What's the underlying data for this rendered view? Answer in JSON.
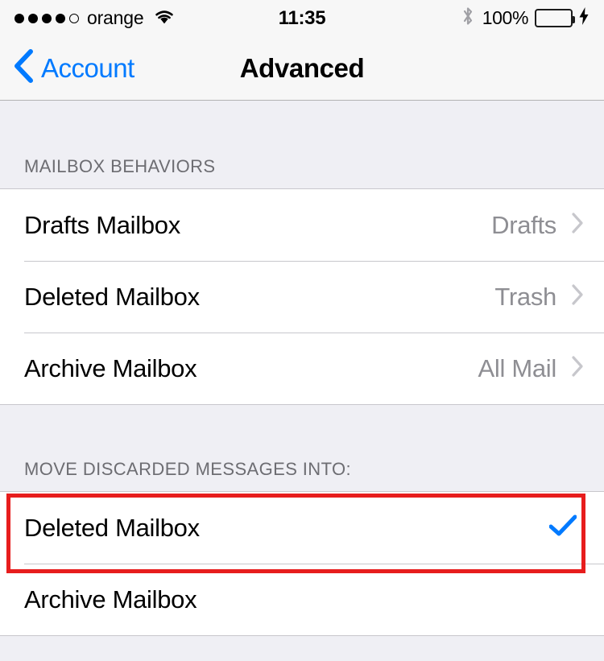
{
  "status_bar": {
    "signal_dots_filled": 4,
    "signal_dots_total": 5,
    "carrier": "orange",
    "wifi_icon": "wifi-icon",
    "time": "11:35",
    "bluetooth_icon": "bluetooth-icon",
    "battery_percent": "100%",
    "battery_level": 100,
    "battery_color": "#4CD964",
    "charging_icon": "lightning-bolt-icon"
  },
  "nav_bar": {
    "back_label": "Account",
    "back_icon": "chevron-left-icon",
    "title": "Advanced",
    "accent_color": "#007AFF"
  },
  "sections": [
    {
      "header": "MAILBOX BEHAVIORS",
      "rows": [
        {
          "label": "Drafts Mailbox",
          "value": "Drafts",
          "accessory": "disclosure"
        },
        {
          "label": "Deleted Mailbox",
          "value": "Trash",
          "accessory": "disclosure"
        },
        {
          "label": "Archive Mailbox",
          "value": "All Mail",
          "accessory": "disclosure"
        }
      ]
    },
    {
      "header": "MOVE DISCARDED MESSAGES INTO:",
      "rows": [
        {
          "label": "Deleted Mailbox",
          "value": "",
          "accessory": "checkmark",
          "selected": true
        },
        {
          "label": "Archive Mailbox",
          "value": "",
          "accessory": "none",
          "selected": false
        }
      ]
    }
  ],
  "annotation": {
    "type": "highlight-rectangle",
    "color": "#E71D1D",
    "target": "Deleted Mailbox"
  }
}
